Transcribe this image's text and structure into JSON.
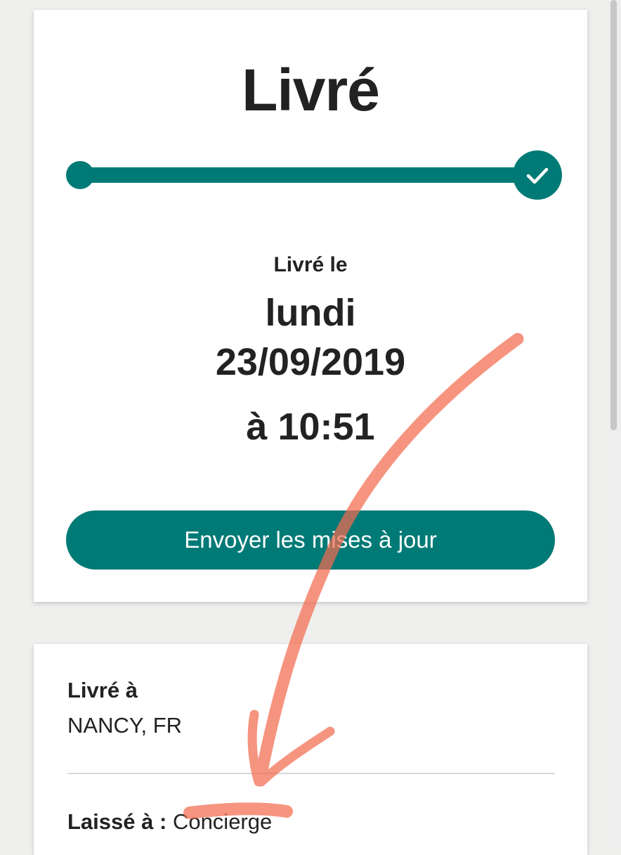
{
  "status": {
    "title": "Livré",
    "progress": 1.0,
    "delivered_label": "Livré le",
    "delivered_day": "lundi",
    "delivered_date": "23/09/2019",
    "delivered_time": "à 10:51",
    "updates_button_label": "Envoyer les mises à jour"
  },
  "details": {
    "location_label": "Livré à",
    "location_value": "NANCY, FR",
    "left_at_label": "Laissé à :",
    "left_at_value": "Concierge"
  },
  "icons": {
    "progress_complete": "checkmark-icon"
  },
  "colors": {
    "accent": "#007a76",
    "annotation": "#f26b4f",
    "background": "#efefee"
  }
}
